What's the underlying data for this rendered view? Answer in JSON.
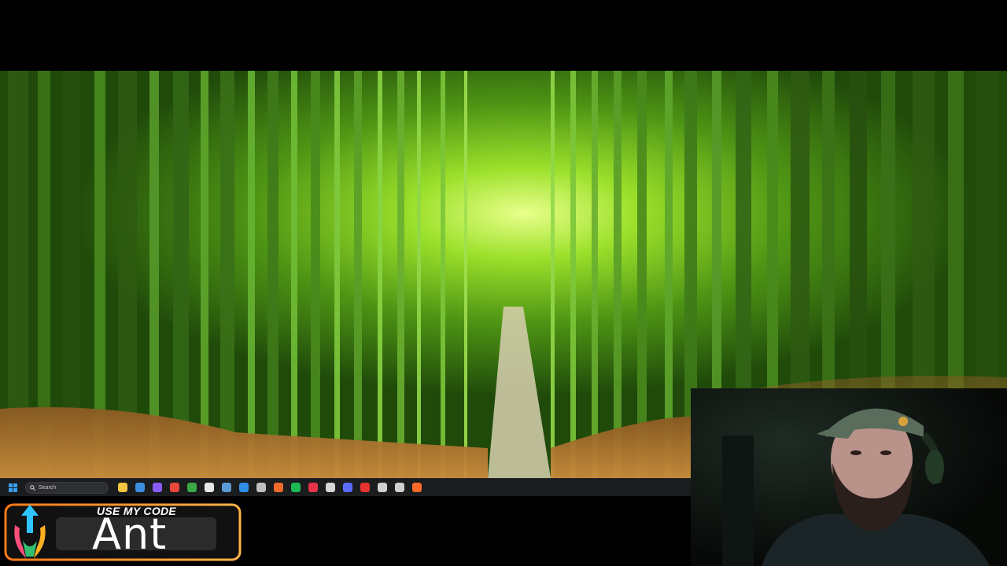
{
  "taskbar": {
    "search_label": "Search",
    "icons": [
      {
        "name": "file-explorer-icon",
        "color": "#f4c542"
      },
      {
        "name": "photos-icon",
        "color": "#3a8fe0"
      },
      {
        "name": "messenger-icon",
        "color": "#8a5cf5"
      },
      {
        "name": "chrome-icon",
        "color": "#e9473b"
      },
      {
        "name": "xbox-icon",
        "color": "#39a845"
      },
      {
        "name": "epic-games-icon",
        "color": "#e8e8e8"
      },
      {
        "name": "steam-icon",
        "color": "#5b9bd5"
      },
      {
        "name": "battlenet-icon",
        "color": "#2f8fe8"
      },
      {
        "name": "obs-icon",
        "color": "#bfbfbf"
      },
      {
        "name": "origin-icon",
        "color": "#f06a2a"
      },
      {
        "name": "spotify-icon",
        "color": "#1db954"
      },
      {
        "name": "tiktok-icon",
        "color": "#e6334b"
      },
      {
        "name": "github-icon",
        "color": "#d7d7d7"
      },
      {
        "name": "streamdeck-icon",
        "color": "#5a6cff"
      },
      {
        "name": "red-app-icon",
        "color": "#e8322f"
      },
      {
        "name": "settings-icon",
        "color": "#d0d0d0"
      },
      {
        "name": "settings-alt-icon",
        "color": "#d0d0d0"
      },
      {
        "name": "orange-app-icon",
        "color": "#ff6a2a"
      }
    ]
  },
  "promo": {
    "small_text": "USE MY CODE",
    "code": "Ant"
  }
}
